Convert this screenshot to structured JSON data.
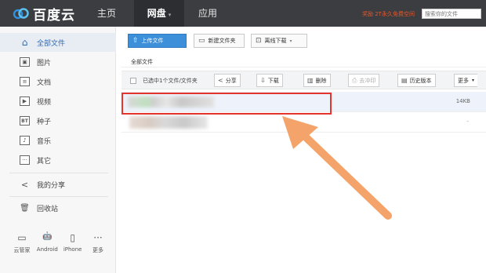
{
  "topbar": {
    "logo_text": "百度云",
    "nav": {
      "home": "主页",
      "disk": "网盘",
      "disk_caret": "▾",
      "app": "应用"
    },
    "promo": "奖励 2T永久免费空间",
    "search_placeholder": "搜索你的文件"
  },
  "sidebar": {
    "items": [
      {
        "label": "全部文件",
        "icon": "folder-icon",
        "glyph": "⌂"
      },
      {
        "label": "图片",
        "icon": "image-icon",
        "glyph": "▣"
      },
      {
        "label": "文档",
        "icon": "document-icon",
        "glyph": "≡"
      },
      {
        "label": "视频",
        "icon": "video-icon",
        "glyph": "▶"
      },
      {
        "label": "种子",
        "icon": "torrent-icon",
        "glyph": "BT"
      },
      {
        "label": "音乐",
        "icon": "music-icon",
        "glyph": "♪"
      },
      {
        "label": "其它",
        "icon": "other-icon",
        "glyph": "···"
      },
      {
        "label": "我的分享",
        "icon": "share-icon",
        "glyph": "<"
      },
      {
        "label": "回收站",
        "icon": "trash-icon",
        "glyph": "🗑"
      }
    ],
    "devices": [
      {
        "label": "云管家",
        "glyph": "▭"
      },
      {
        "label": "Android",
        "glyph": "🤖"
      },
      {
        "label": "iPhone",
        "glyph": "▯"
      },
      {
        "label": "更多",
        "glyph": "···"
      }
    ]
  },
  "toolbar": {
    "upload": "上传文件",
    "new_folder": "新建文件夹",
    "offline": "离线下载"
  },
  "breadcrumb": "全部文件",
  "actionbar": {
    "selected_info": "已选中1个文件/文件夹",
    "share": "分享",
    "download": "下载",
    "delete": "删除",
    "extract": "去冲印",
    "history": "历史版本",
    "more": "更多"
  },
  "files": [
    {
      "size": "14KB",
      "selected": true
    },
    {
      "size": "-",
      "selected": false
    }
  ],
  "colors": {
    "topbar": "#3b3d40",
    "accent": "#3d8fd9",
    "highlight": "#e4342e",
    "arrow": "#f4a46a"
  }
}
